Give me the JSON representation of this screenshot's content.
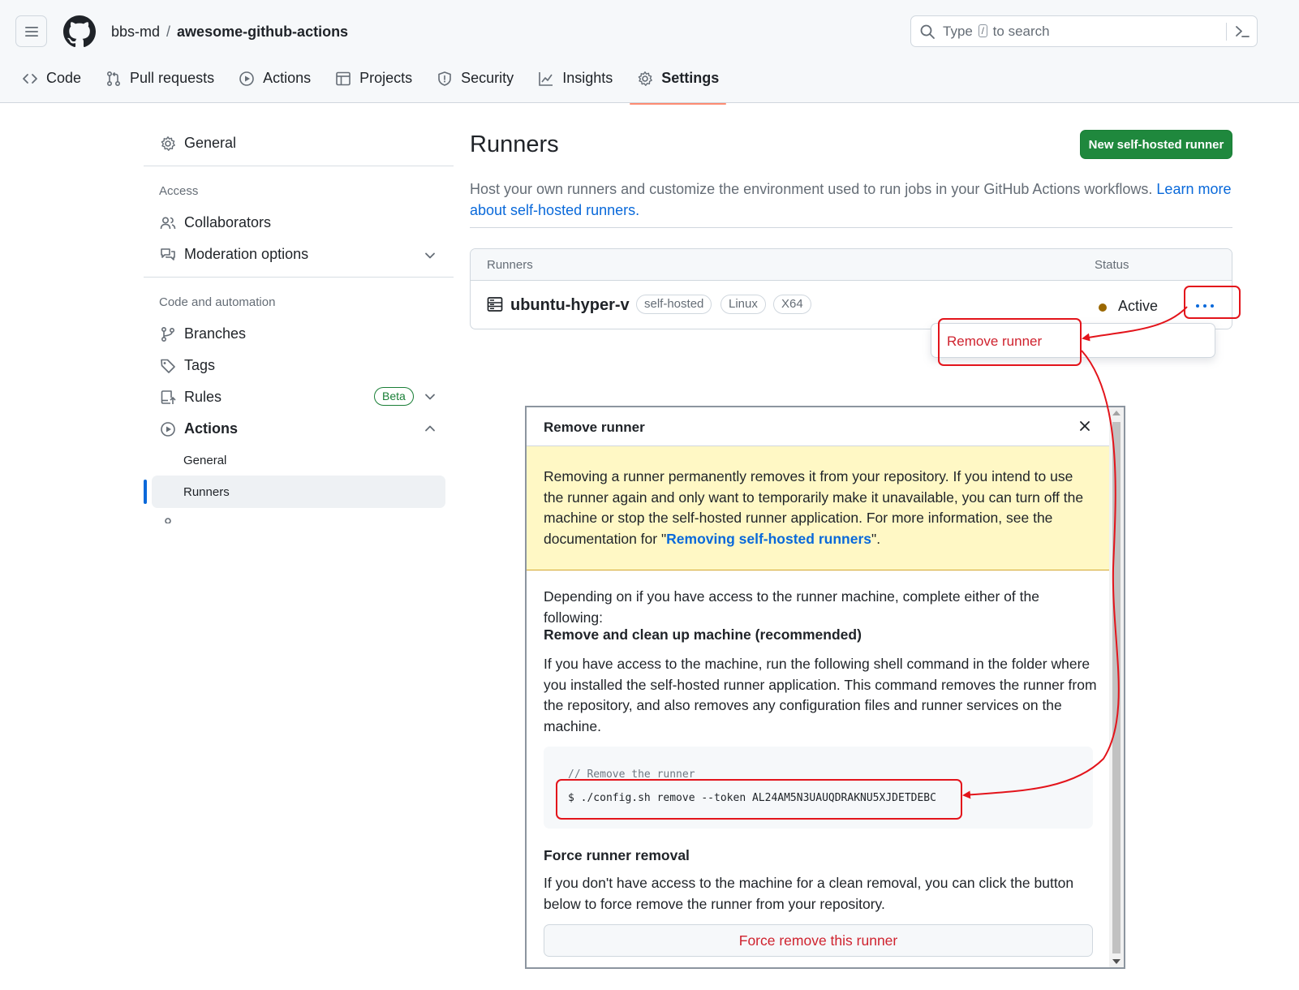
{
  "header": {
    "owner": "bbs-md",
    "separator": "/",
    "repo": "awesome-github-actions",
    "search_before": "Type",
    "search_key": "/",
    "search_after": "to search"
  },
  "tabs": [
    {
      "label": "Code",
      "icon": "code-icon"
    },
    {
      "label": "Pull requests",
      "icon": "git-pull-request-icon"
    },
    {
      "label": "Actions",
      "icon": "play-icon"
    },
    {
      "label": "Projects",
      "icon": "table-icon"
    },
    {
      "label": "Security",
      "icon": "shield-icon"
    },
    {
      "label": "Insights",
      "icon": "graph-icon"
    },
    {
      "label": "Settings",
      "icon": "gear-icon",
      "active": true
    }
  ],
  "sidebar": {
    "general": "General",
    "access_heading": "Access",
    "collaborators": "Collaborators",
    "moderation": "Moderation options",
    "code_heading": "Code and automation",
    "branches": "Branches",
    "tags": "Tags",
    "rules": "Rules",
    "rules_badge": "Beta",
    "actions": "Actions",
    "actions_general": "General",
    "actions_runners": "Runners"
  },
  "main": {
    "title": "Runners",
    "new_button": "New self-hosted runner",
    "description": "Host your own runners and customize the environment used to run jobs in your GitHub Actions workflows.",
    "learn_more": "Learn more about self-hosted runners."
  },
  "table": {
    "col_runners": "Runners",
    "col_status": "Status",
    "runner": {
      "name": "ubuntu-hyper-v",
      "labels": [
        "self-hosted",
        "Linux",
        "X64"
      ],
      "status": "Active"
    }
  },
  "menu": {
    "remove_runner": "Remove runner"
  },
  "modal": {
    "title": "Remove runner",
    "warning_text": "Removing a runner permanently removes it from your repository. If you intend to use the runner again and only want to temporarily make it unavailable, you can turn off the machine or stop the self-hosted runner application. For more information, see the documentation for \"",
    "warning_link": "Removing self-hosted runners",
    "warning_end": "\".",
    "intro": "Depending on if you have access to the runner machine, complete either of the following:",
    "section1_heading": "Remove and clean up machine (recommended)",
    "section1_text": "If you have access to the machine, run the following shell command in the folder where you installed the self-hosted runner application. This command removes the runner from the repository, and also removes any configuration files and runner services on the machine.",
    "code_comment": "// Remove the runner",
    "code_command": "$ ./config.sh remove --token AL24AM5N3UAUQDRAKNU5XJDETDEBC",
    "section2_heading": "Force runner removal",
    "section2_text": "If you don't have access to the machine for a clean removal, you can click the button below to force remove the runner from your repository.",
    "force_button": "Force remove this runner"
  },
  "colors": {
    "accent": "#0969da",
    "primary_button": "#1f883d",
    "danger": "#cf222e",
    "annotation": "#e3141b",
    "active_tab_underline": "#fd8c73",
    "status_dot": "#9a6700",
    "warning_bg": "#fff8c5"
  }
}
